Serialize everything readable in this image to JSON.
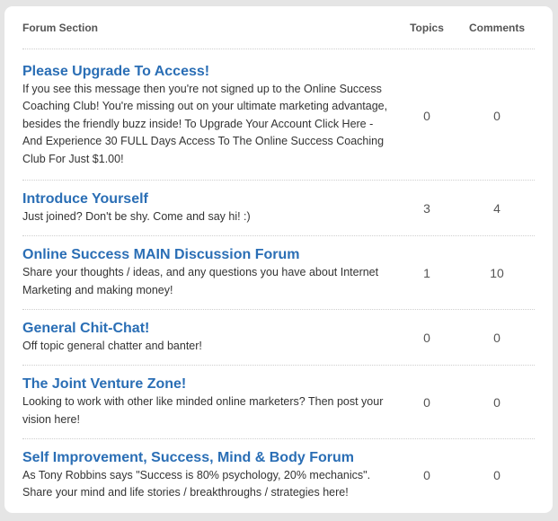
{
  "header": {
    "section": "Forum Section",
    "topics": "Topics",
    "comments": "Comments"
  },
  "forums": [
    {
      "title": "Please Upgrade To Access!",
      "description": "If you see this message then you're not signed up to the Online Success Coaching Club! You're missing out on your ultimate marketing advantage, besides the friendly buzz inside! To Upgrade Your Account Click Here - And Experience 30 FULL Days Access To The Online Success Coaching Club For Just $1.00!",
      "topics": "0",
      "comments": "0"
    },
    {
      "title": "Introduce Yourself",
      "description": "Just joined? Don't be shy. Come and say hi! :)",
      "topics": "3",
      "comments": "4"
    },
    {
      "title": "Online Success MAIN Discussion Forum",
      "description": "Share your thoughts / ideas, and any questions you have about Internet Marketing and making money!",
      "topics": "1",
      "comments": "10"
    },
    {
      "title": "General Chit-Chat!",
      "description": "Off topic general chatter and banter!",
      "topics": "0",
      "comments": "0"
    },
    {
      "title": "The Joint Venture Zone!",
      "description": "Looking to work with other like minded online marketers? Then post your vision here!",
      "topics": "0",
      "comments": "0"
    },
    {
      "title": "Self Improvement, Success, Mind & Body Forum",
      "description": "As Tony Robbins says \"Success is 80% psychology, 20% mechanics\". Share your mind and life stories / breakthroughs / strategies here!",
      "topics": "0",
      "comments": "0"
    }
  ]
}
